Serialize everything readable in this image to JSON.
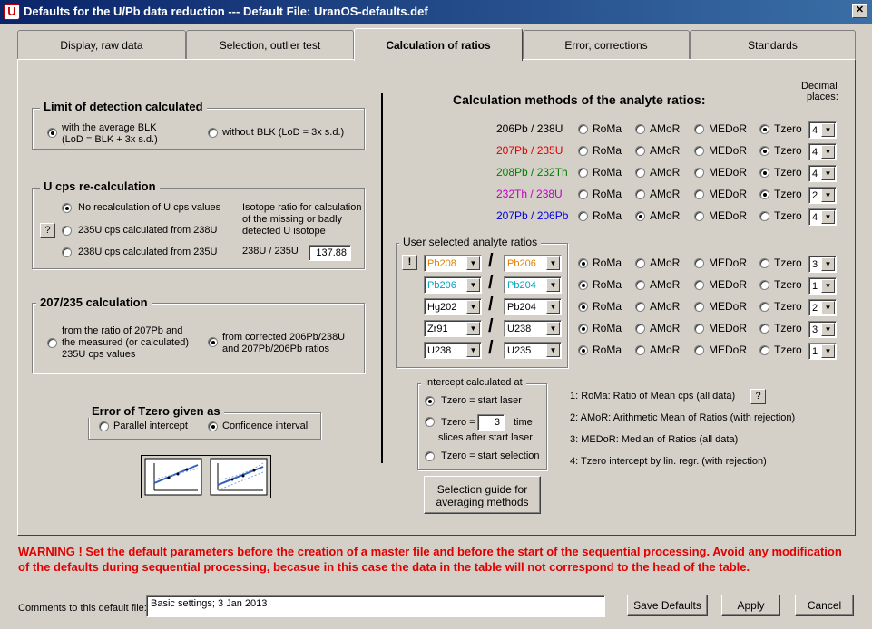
{
  "window": {
    "title": "Defaults for the U/Pb data reduction   ---   Default File: UranOS-defaults.def",
    "app_icon_letter": "U",
    "close_symbol": "✕"
  },
  "tabs": [
    "Display, raw data",
    "Selection, outlier test",
    "Calculation of ratios",
    "Error, corrections",
    "Standards"
  ],
  "lod": {
    "title": "Limit of detection calculated",
    "opt1_line1": "with the average BLK",
    "opt1_line2": "(LoD = BLK + 3x s.d.)",
    "opt2": "without BLK (LoD = 3x s.d.)"
  },
  "ucps": {
    "title": "U cps re-calculation",
    "opt1": "No recalculation of U cps values",
    "opt2": "235U cps calculated from 238U",
    "opt3": "238U cps calculated from 235U",
    "help": "?",
    "iso_line1": "Isotope ratio for calculation",
    "iso_line2": "of the missing or badly",
    "iso_line3": "detected U isotope",
    "iso_label": "238U / 235U",
    "iso_value": "137.88"
  },
  "calc207": {
    "title": "207/235 calculation",
    "opt1_line1": "from the ratio of 207Pb and",
    "opt1_line2": "the measured (or calculated)",
    "opt1_line3": "235U cps values",
    "opt2_line1": "from corrected 206Pb/238U",
    "opt2_line2": "and 207Pb/206Pb ratios"
  },
  "tzero_err": {
    "title": "Error of Tzero given as",
    "opt1": "Parallel intercept",
    "opt2": "Confidence interval"
  },
  "methods": {
    "title": "Calculation methods of the analyte ratios:",
    "decimal_line1": "Decimal",
    "decimal_line2": "places:",
    "method_names": [
      "RoMa",
      "AMoR",
      "MEDoR",
      "Tzero"
    ],
    "rows": [
      {
        "label": "206Pb / 238U",
        "color": "#000000",
        "decimals": "4"
      },
      {
        "label": "207Pb / 235U",
        "color": "#e00000",
        "decimals": "4"
      },
      {
        "label": "208Pb / 232Th",
        "color": "#008000",
        "decimals": "4"
      },
      {
        "label": "232Th / 238U",
        "color": "#c000c0",
        "decimals": "2"
      },
      {
        "label": "207Pb / 206Pb",
        "color": "#0000e0",
        "decimals": "4"
      }
    ]
  },
  "user": {
    "title": "User selected analyte ratios",
    "btn": "!",
    "rows": [
      {
        "num": "Pb208",
        "num_color": "#e08000",
        "den": "Pb206",
        "den_color": "#e08000",
        "decimals": "3"
      },
      {
        "num": "Pb206",
        "num_color": "#00a0c0",
        "den": "Pb204",
        "den_color": "#00a0c0",
        "decimals": "1"
      },
      {
        "num": "Hg202",
        "num_color": "#000000",
        "den": "Pb204",
        "den_color": "#000000",
        "decimals": "2"
      },
      {
        "num": "Zr91",
        "num_color": "#000000",
        "den": "U238",
        "den_color": "#000000",
        "decimals": "3"
      },
      {
        "num": "U238",
        "num_color": "#000000",
        "den": "U235",
        "den_color": "#000000",
        "decimals": "1"
      }
    ]
  },
  "intercept": {
    "title": "Intercept calculated at",
    "opt1": "Tzero = start laser",
    "opt2_a": "Tzero =",
    "opt2_value": "3",
    "opt2_b": "time",
    "opt2_c": "slices after start laser",
    "opt3": "Tzero = start selection"
  },
  "legend": {
    "l1": "1: RoMa:  Ratio of Mean cps  (all data)",
    "l2": "2: AMoR:  Arithmetic  Mean of Ratios (with rejection)",
    "l3": "3: MEDoR:  Median of Ratios  (all data)",
    "l4": "4: Tzero intercept by lin. regr.  (with rejection)",
    "help": "?"
  },
  "guide_btn": {
    "line1": "Selection guide for",
    "line2": "averaging methods"
  },
  "warning": "WARNING !   Set the default parameters before the creation of a master file and before the start of the sequential processing. Avoid any modification of the defaults during sequential processing, becasue in this case the data in the table will not correspond to the head of the table.",
  "footer": {
    "comments_label": "Comments to this default file:",
    "comments_value": "Basic settings; 3 Jan 2013",
    "save": "Save Defaults",
    "apply": "Apply",
    "cancel": "Cancel"
  },
  "icons": {
    "dropdown": "▼"
  }
}
